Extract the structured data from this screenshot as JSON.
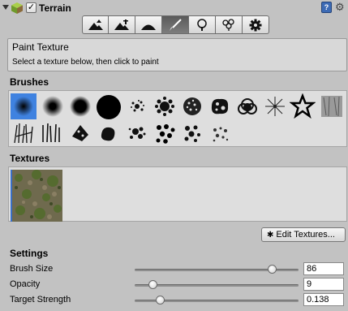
{
  "header": {
    "title": "Terrain",
    "enabled_mark": "✓",
    "help_glyph": "?",
    "gear_glyph": "⚙"
  },
  "toolbar": {
    "tools": [
      {
        "name": "raise-lower",
        "icon": "mountain-up-icon"
      },
      {
        "name": "paint-height",
        "icon": "mountain-height-icon"
      },
      {
        "name": "smooth-height",
        "icon": "mountain-smooth-icon"
      },
      {
        "name": "paint-texture",
        "icon": "paintbrush-icon",
        "active": true
      },
      {
        "name": "place-trees",
        "icon": "tree-icon"
      },
      {
        "name": "paint-details",
        "icon": "flowers-icon"
      },
      {
        "name": "terrain-settings",
        "icon": "gear-icon"
      }
    ]
  },
  "info": {
    "title": "Paint Texture",
    "subtitle": "Select a texture below, then click to paint"
  },
  "sections": {
    "brushes": "Brushes",
    "textures": "Textures",
    "settings": "Settings"
  },
  "brushes": {
    "count": 21,
    "selected_index": 0
  },
  "buttons": {
    "edit_textures": "Edit Textures...",
    "edit_glyph": "✱"
  },
  "settings": [
    {
      "label": "Brush Size",
      "value": "86",
      "fraction": 0.86
    },
    {
      "label": "Opacity",
      "value": "9",
      "fraction": 0.09
    },
    {
      "label": "Target Strength",
      "value": "0.138",
      "fraction": 0.138
    }
  ],
  "colors": {
    "background": "#c2c2c2",
    "selection": "#3f82e0",
    "active_tool": "#5a5a5a"
  }
}
